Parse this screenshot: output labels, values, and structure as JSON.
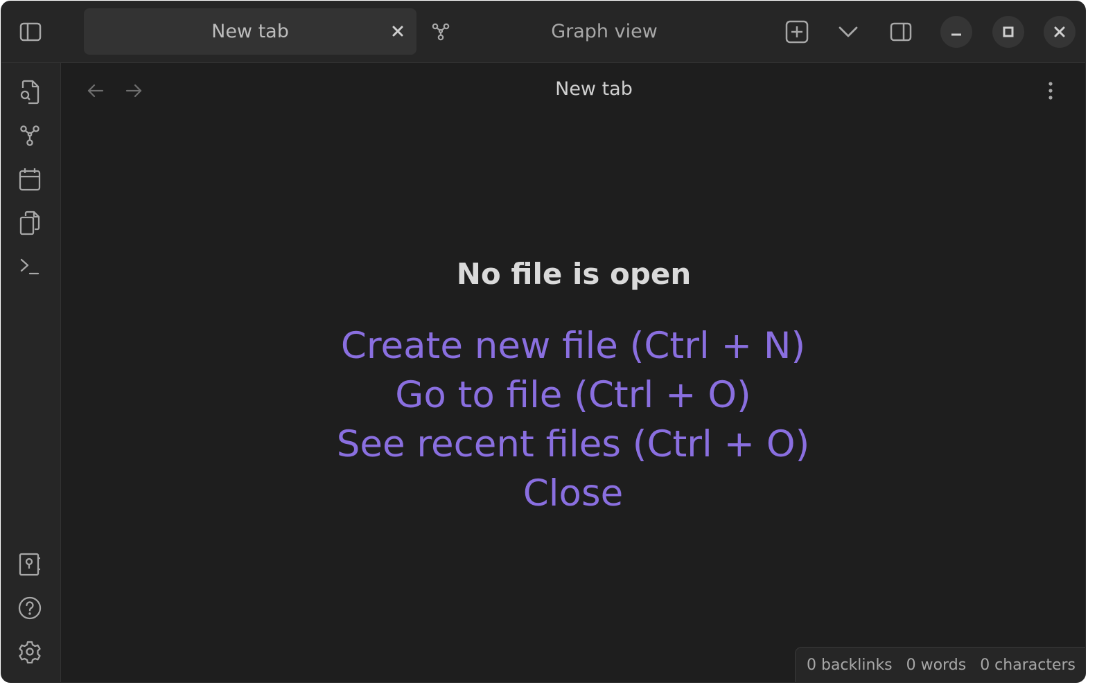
{
  "titlebar": {
    "tabs": [
      {
        "label": "New tab",
        "active": true
      },
      {
        "label": "Graph view",
        "active": false
      }
    ]
  },
  "header": {
    "title": "New tab"
  },
  "empty_state": {
    "title": "No file is open",
    "actions": [
      {
        "label": "Create new file (Ctrl + N)"
      },
      {
        "label": "Go to file (Ctrl + O)"
      },
      {
        "label": "See recent files (Ctrl + O)"
      },
      {
        "label": "Close"
      }
    ]
  },
  "statusbar": {
    "backlinks": "0 backlinks",
    "words": "0 words",
    "characters": "0 characters"
  },
  "ribbon": {
    "top_icons": [
      "file-search-icon",
      "graph-icon",
      "calendar-icon",
      "copy-files-icon",
      "terminal-icon"
    ],
    "bottom_icons": [
      "vault-icon",
      "help-icon",
      "settings-icon"
    ]
  },
  "colors": {
    "background": "#1e1e1e",
    "chrome": "#262626",
    "accent": "#8a6fe0",
    "text": "#dadada",
    "muted": "#a8a8a8"
  }
}
